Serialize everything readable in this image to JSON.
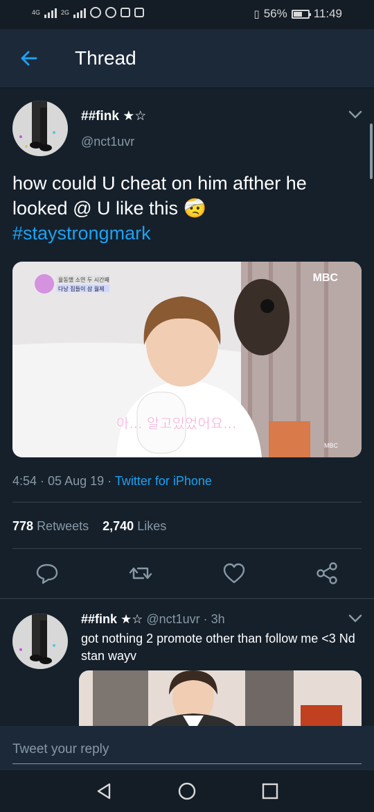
{
  "status_bar": {
    "network1": "4G",
    "network2": "2G",
    "battery_percent": "56%",
    "time": "11:49"
  },
  "header": {
    "title": "Thread",
    "back_icon": "arrow-left-icon"
  },
  "tweet": {
    "display_name": "##fink ★☆",
    "handle": "@nct1uvr",
    "text": "how could U cheat on him afther he looked @ U like this 🤕",
    "hashtag": "#staystrongmark",
    "media": {
      "logo": "MBC",
      "caption": "아... 알고있었어요...",
      "corner": "MBC",
      "tag1": "율동했 소연 두 시간째",
      "tag2": "다낭 집들이 삼 월제"
    },
    "time": "4:54",
    "date": "05 Aug 19",
    "source": "Twitter for iPhone",
    "retweets_count": "778",
    "retweets_label": "Retweets",
    "likes_count": "2,740",
    "likes_label": "Likes"
  },
  "actions": [
    "reply-icon",
    "retweet-icon",
    "like-icon",
    "share-icon"
  ],
  "reply": {
    "display_name": "##fink ★☆",
    "handle": "@nct1uvr",
    "age": "3h",
    "text": "got nothing 2 promote other than follow me <3 Nd stan wayv"
  },
  "reply_bar": {
    "placeholder": "Tweet your reply"
  },
  "colors": {
    "background": "#15202b",
    "header": "#1c2938",
    "accent": "#1da1f2",
    "secondary_text": "#8899a6"
  }
}
